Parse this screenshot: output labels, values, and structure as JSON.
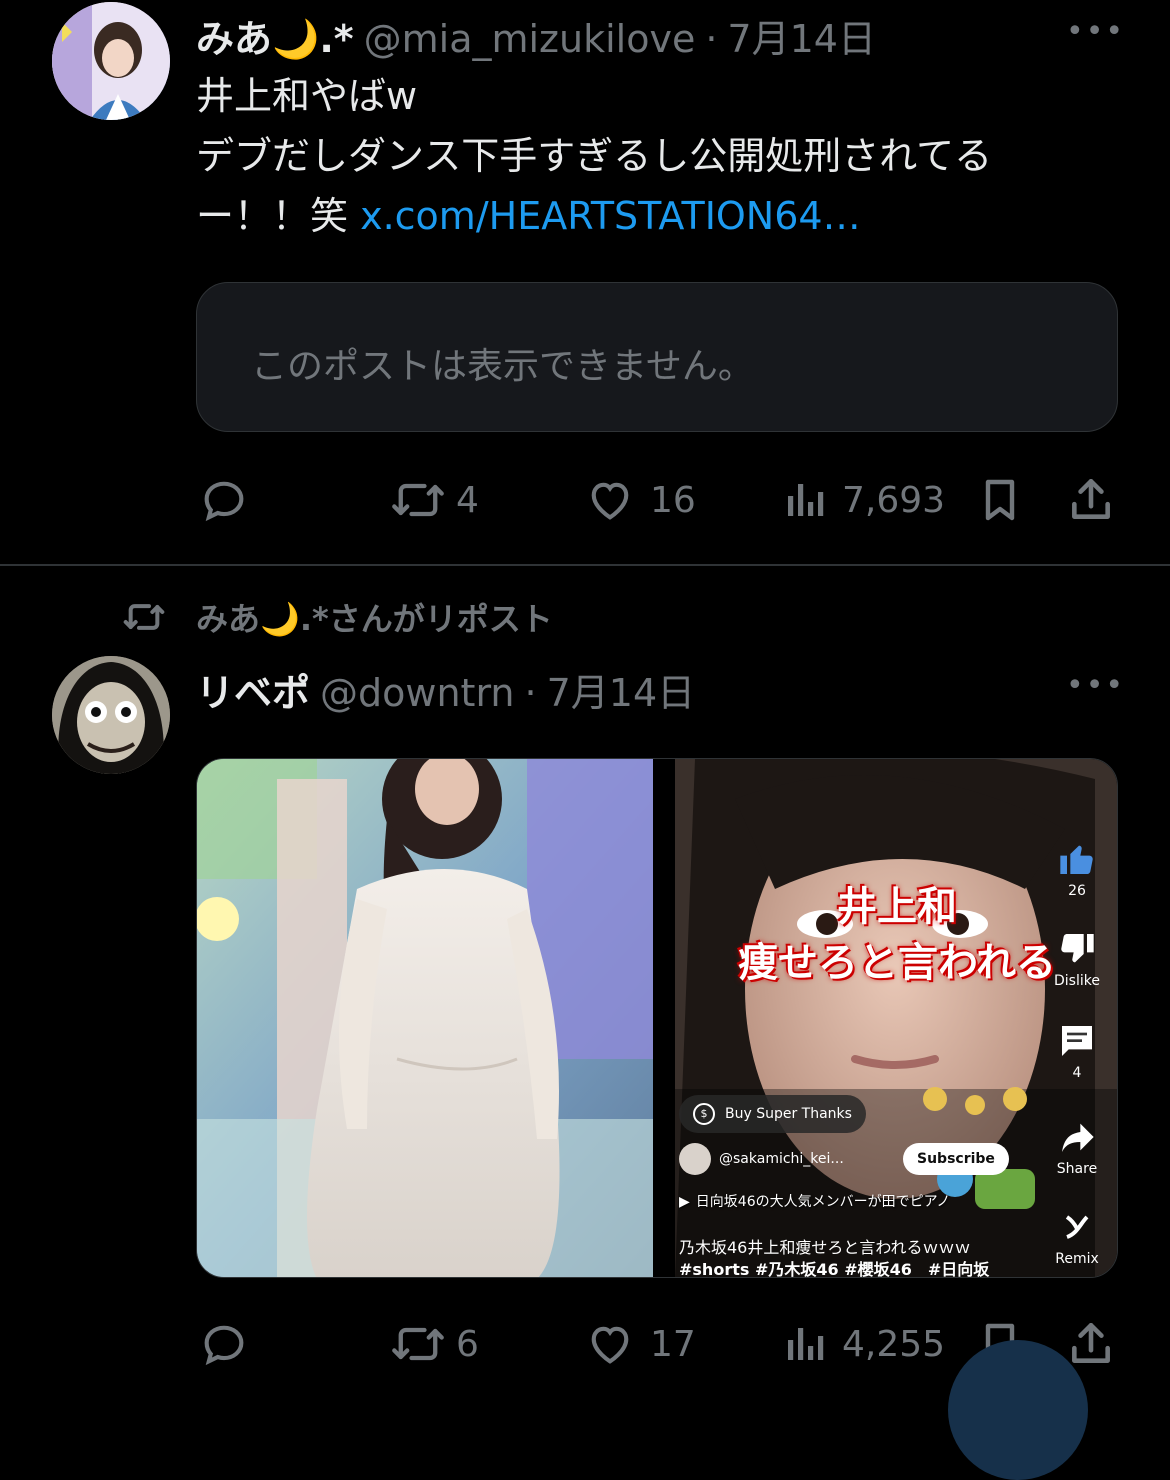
{
  "tweet1": {
    "display_name": "みあ🌙.*",
    "handle": "@mia_mizukilove",
    "separator": "·",
    "date": "7月14日",
    "more": "•••",
    "lines": [
      "井上和やばw",
      "デブだしダンス下手すぎるし公開処刑されてる",
      "ー！！笑 "
    ],
    "link": "x.com/HEARTSTATION64…",
    "quote_unavailable": "このポストは表示できません。",
    "stats": {
      "reposts": "4",
      "likes": "16",
      "views": "7,693"
    }
  },
  "repost_banner": "みあ🌙.*さんがリポスト",
  "tweet2": {
    "display_name": "リベポ",
    "handle": "@downtrn",
    "separator": "·",
    "date": "7月14日",
    "more": "•••",
    "short": {
      "overlay_line1": "井上和",
      "overlay_line2": "痩せろと言われる",
      "like_count": "26",
      "dislike_label": "Dislike",
      "comment_count": "4",
      "share_label": "Share",
      "remix_label": "Remix",
      "super_thanks": "Buy Super Thanks",
      "channel": "@sakamichi_kei...",
      "subscribe": "Subscribe",
      "ticker": "日向坂46の大人気メンバーが田でピアノ",
      "caption_line1": "乃木坂46井上和痩せろと言われるｗｗｗ",
      "caption_line2": "#shorts #乃木坂46 #櫻坂46　#日向坂"
    },
    "stats": {
      "reposts": "6",
      "likes": "17",
      "views": "4,255"
    }
  },
  "colors": {
    "background": "#000000",
    "text": "#e7e9ea",
    "muted": "#71767b",
    "link": "#1d9bf0"
  }
}
